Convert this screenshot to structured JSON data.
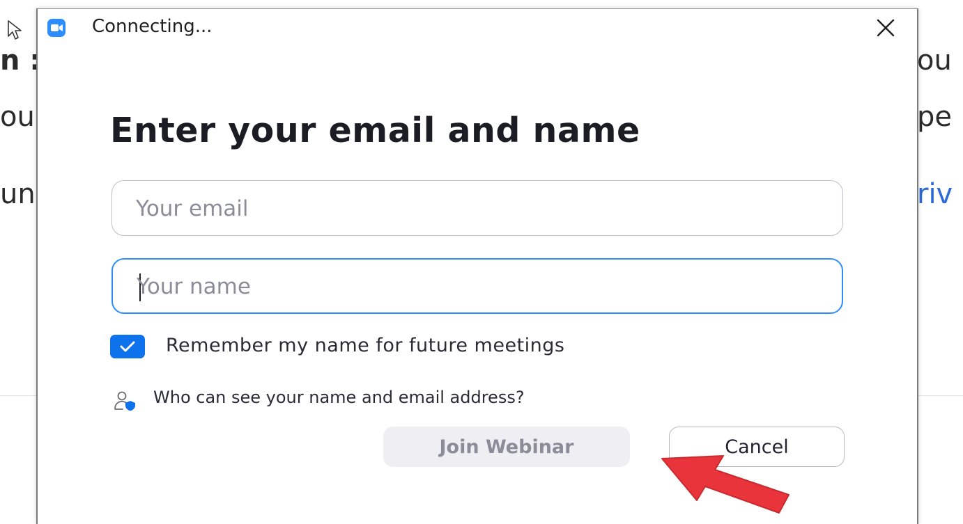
{
  "dialog": {
    "title": "Connecting...",
    "heading": "Enter your email and name",
    "email_placeholder": "Your email",
    "email_value": "",
    "name_placeholder": "Your name",
    "name_value": "",
    "remember_label": "Remember my name for future meetings",
    "remember_checked": true,
    "privacy_link": "Who can see your name and email address?",
    "join_button": "Join Webinar",
    "join_enabled": false,
    "cancel_button": "Cancel"
  },
  "background": {
    "left_fragments": [
      "n :",
      "ou",
      "un"
    ],
    "right_fragments": [
      "ou",
      "pe",
      "riv"
    ]
  },
  "icons": {
    "app": "video-camera-icon",
    "close": "close-icon",
    "checkbox": "checkmark-icon",
    "privacy": "user-shield-icon",
    "annotation": "red-arrow-icon",
    "cursor": "mouse-pointer-icon"
  },
  "colors": {
    "accent": "#0e72ed",
    "focus_border": "#2d8cff",
    "disabled_button_bg": "#eeeef3",
    "annotation_arrow": "#e8343a"
  }
}
